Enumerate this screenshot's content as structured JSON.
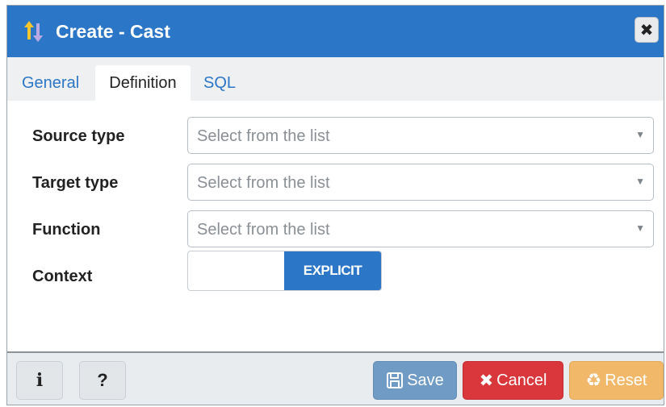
{
  "dialog": {
    "title": "Create - Cast",
    "close_icon": "close-icon",
    "title_icon": "cast-icon"
  },
  "tabs": [
    {
      "label": "General",
      "active": false
    },
    {
      "label": "Definition",
      "active": true
    },
    {
      "label": "SQL",
      "active": false
    }
  ],
  "form": {
    "source_type": {
      "label": "Source type",
      "placeholder": "Select from the list"
    },
    "target_type": {
      "label": "Target type",
      "placeholder": "Select from the list"
    },
    "function": {
      "label": "Function",
      "placeholder": "Select from the list"
    },
    "context": {
      "label": "Context",
      "value": "EXPLICIT"
    }
  },
  "footer": {
    "info_label": "i",
    "help_label": "?",
    "save_label": "Save",
    "cancel_label": "Cancel",
    "reset_label": "Reset"
  },
  "colors": {
    "accent": "#2c76c7",
    "save": "#6f9bc4",
    "cancel": "#d9373c",
    "reset": "#f1b86a"
  }
}
